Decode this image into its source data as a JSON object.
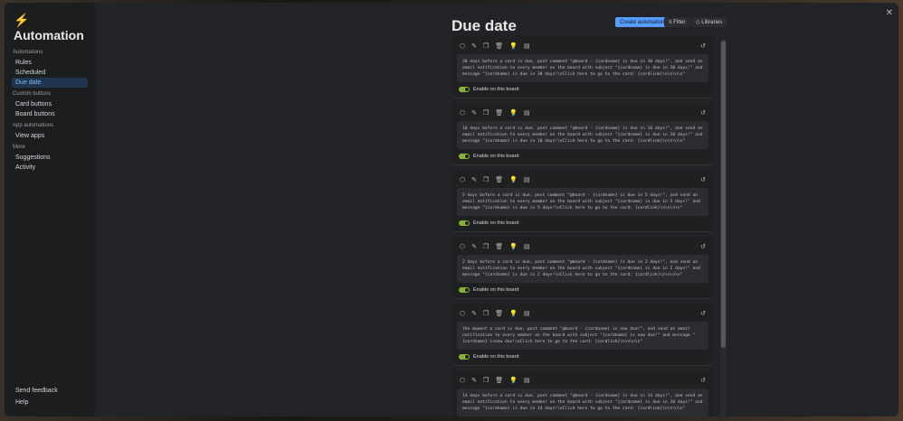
{
  "sidebar": {
    "title": "Automation",
    "sections": [
      {
        "label": "Automations",
        "items": [
          "Rules",
          "Scheduled",
          "Due date"
        ]
      },
      {
        "label": "Custom buttons",
        "items": [
          "Card buttons",
          "Board buttons"
        ]
      },
      {
        "label": "App automations",
        "items": [
          "View apps"
        ]
      },
      {
        "label": "More",
        "items": [
          "Suggestions",
          "Activity"
        ]
      }
    ],
    "active": "Due date",
    "bottom": [
      "Send feedback",
      "Help"
    ]
  },
  "header": {
    "title": "Due date",
    "create": "Create automation",
    "filter": "Filter",
    "libraries": "Libraries"
  },
  "toggle_label": "Enable on this board",
  "rules": [
    "30 days before a card is due, post comment \"@board - {cardname} is due in 30 days!\", and send an email notification to every member on the board with subject \"{cardname} is due in 30 days!\" and message \"{cardname} is due in 30 days!\\nClick here to go to the card: {cardlink}\\n\\n\\n\\n\"",
    "10 days before a card is due, post comment \"@board - {cardname} is due in 10 days!\", and send an email notification to every member on the board with subject \"{cardname} is due in 10 days!\" and message \"{cardname} is due in 10 days!\\nClick here to go to the card: {cardlink}\\n\\n\\n\\n\"",
    "5 days before a card is due, post comment \"@board - {cardname} is due in 5 days!\", and send an email notification to every member on the board with subject \"{cardname} is due in 5 days!\" and message \"{cardname} is due in 5 days!\\nClick here to go to the card: {cardlink}\\n\\n\\n\\n\"",
    "2 days before a card is due, post comment \"@board - {cardname} is due in 2 days!\", and send an email notification to every member on the board with subject \"{cardname} is due in 2 days!\" and message \"{cardname} is due in 2 days!\\nClick here to go to the card: {cardlink}\\n\\n\\n\\n\"",
    "the moment a card is due, post comment \"@board - {cardname} is now due!\", and send an email notification to every member on the board with subject \"{cardname} is now due!\" and message \"{cardname} isnow due!\\nClick here to go to the card: {cardlink}\\n\\n\\n\\n\"",
    "14 days before a card is due, post comment \"@board - {cardname} is due in 14 days!\", and send an email notification to every member on the board with subject \"{cardname} is due in 30 days!\" and message \"{cardname} is due in 14 days!\\nClick here to go to the card: {cardlink}\\n\\n\\n\\n\""
  ]
}
